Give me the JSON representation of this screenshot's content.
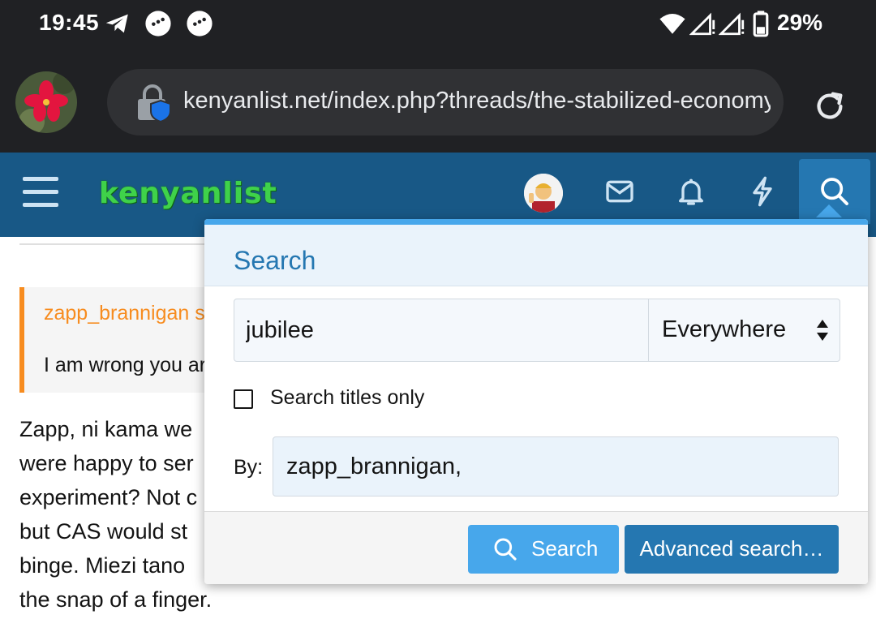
{
  "status_bar": {
    "time": "19:45",
    "battery_percent": "29%",
    "icons": [
      "telegram-icon",
      "chat-bubble-icon",
      "chat-bubble-icon",
      "wifi-icon",
      "signal-icon",
      "signal-icon",
      "battery-icon"
    ]
  },
  "browser": {
    "url": "kenyanlist.net/index.php?threads/the-stabilized-economy-i",
    "icons": [
      "profile-avatar",
      "lock-shield-icon",
      "reload-icon"
    ]
  },
  "site_header": {
    "logo_text": "kenyanlist",
    "icons": [
      "hamburger-menu-icon",
      "user-avatar",
      "envelope-icon",
      "bell-icon",
      "lightning-icon",
      "search-icon"
    ]
  },
  "post": {
    "quote_author": "zapp_brannigan s",
    "quote_text": "I am wrong you ar",
    "lines": [
      "Zapp, ni kama we",
      "were happy to ser",
      "experiment? Not c",
      "but CAS would st",
      "binge. Miezi tano",
      "the snap of a finger."
    ]
  },
  "search_popup": {
    "title": "Search",
    "query_value": "jubilee",
    "scope_selected": "Everywhere",
    "titles_only_label": "Search titles only",
    "titles_only_checked": false,
    "by_label": "By:",
    "by_value": "zapp_brannigan,",
    "search_button_label": "Search",
    "advanced_button_label": "Advanced search…"
  },
  "colors": {
    "status_bg": "#202124",
    "header_bg": "#185886",
    "accent": "#47a7eb",
    "accent_dark": "#2577b1",
    "quote_border": "#f78c1f",
    "logo_green": "#3fd24a"
  }
}
